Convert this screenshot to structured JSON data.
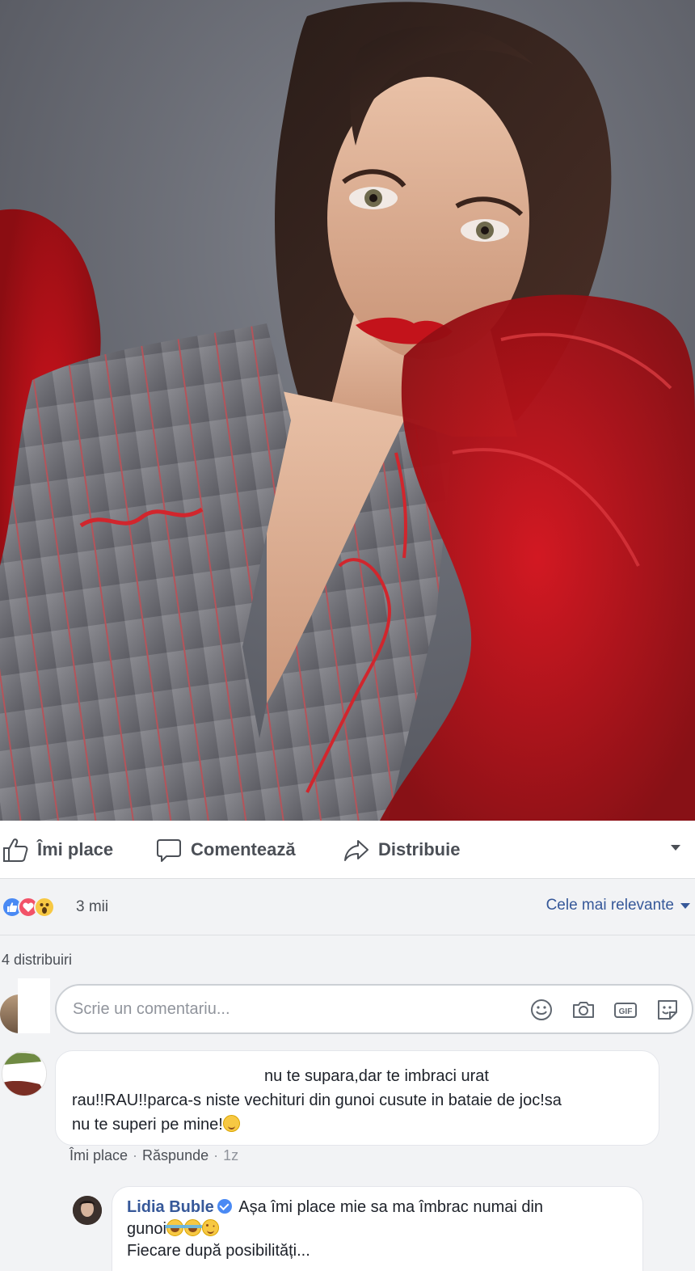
{
  "post": {
    "photo_alt": "Woman with red lipstick in grey pinstripe blazer with red tulle"
  },
  "actions": {
    "like_label": "Îmi place",
    "comment_label": "Comentează",
    "share_label": "Distribuie"
  },
  "reactions": {
    "types": [
      "like",
      "love",
      "wow"
    ],
    "count_label": "3 mii",
    "sort_label": "Cele mai relevante"
  },
  "shares_label": "4 distribuiri",
  "composer": {
    "placeholder": "Scrie un comentariu...",
    "icons": [
      "emoji-icon",
      "camera-icon",
      "gif-icon",
      "sticker-icon"
    ]
  },
  "comments": [
    {
      "line1": "nu te supara,dar te imbraci urat",
      "line2": "rau!!RAU!!parca-s niste vechituri din gunoi cusute in bataie de joc!sa",
      "line3": "nu te superi pe mine!",
      "meta": {
        "like": "Îmi place",
        "reply": "Răspunde",
        "time": "1z"
      }
    }
  ],
  "reply": {
    "author": "Lidia Buble",
    "text_part1": "Așa îmi place mie sa ma îmbrac numai din",
    "text_part2": "gunoi",
    "text_part3": "Fiecare după posibilități..."
  },
  "colors": {
    "link": "#365899",
    "like_blue": "#4a8af4",
    "love_red": "#f25268",
    "wow_yellow": "#f7c843",
    "background": "#f2f3f5"
  }
}
